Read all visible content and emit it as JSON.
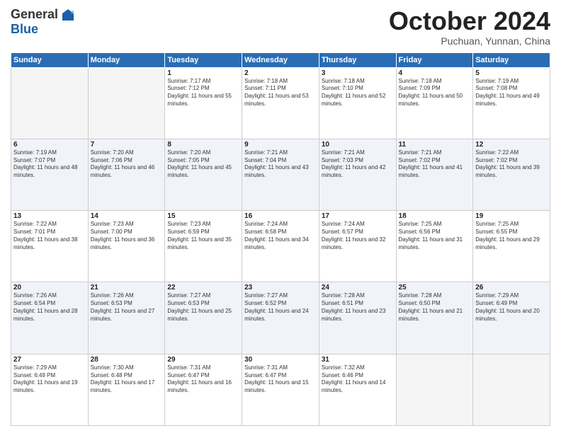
{
  "logo": {
    "general": "General",
    "blue": "Blue"
  },
  "title": "October 2024",
  "subtitle": "Puchuan, Yunnan, China",
  "weekdays": [
    "Sunday",
    "Monday",
    "Tuesday",
    "Wednesday",
    "Thursday",
    "Friday",
    "Saturday"
  ],
  "weeks": [
    [
      {
        "day": "",
        "empty": true
      },
      {
        "day": "",
        "empty": true
      },
      {
        "day": "1",
        "sunrise": "7:17 AM",
        "sunset": "7:12 PM",
        "daylight": "11 hours and 55 minutes."
      },
      {
        "day": "2",
        "sunrise": "7:18 AM",
        "sunset": "7:11 PM",
        "daylight": "11 hours and 53 minutes."
      },
      {
        "day": "3",
        "sunrise": "7:18 AM",
        "sunset": "7:10 PM",
        "daylight": "11 hours and 52 minutes."
      },
      {
        "day": "4",
        "sunrise": "7:18 AM",
        "sunset": "7:09 PM",
        "daylight": "11 hours and 50 minutes."
      },
      {
        "day": "5",
        "sunrise": "7:19 AM",
        "sunset": "7:08 PM",
        "daylight": "11 hours and 49 minutes."
      }
    ],
    [
      {
        "day": "6",
        "sunrise": "7:19 AM",
        "sunset": "7:07 PM",
        "daylight": "11 hours and 48 minutes."
      },
      {
        "day": "7",
        "sunrise": "7:20 AM",
        "sunset": "7:06 PM",
        "daylight": "11 hours and 46 minutes."
      },
      {
        "day": "8",
        "sunrise": "7:20 AM",
        "sunset": "7:05 PM",
        "daylight": "11 hours and 45 minutes."
      },
      {
        "day": "9",
        "sunrise": "7:21 AM",
        "sunset": "7:04 PM",
        "daylight": "11 hours and 43 minutes."
      },
      {
        "day": "10",
        "sunrise": "7:21 AM",
        "sunset": "7:03 PM",
        "daylight": "11 hours and 42 minutes."
      },
      {
        "day": "11",
        "sunrise": "7:21 AM",
        "sunset": "7:02 PM",
        "daylight": "11 hours and 41 minutes."
      },
      {
        "day": "12",
        "sunrise": "7:22 AM",
        "sunset": "7:02 PM",
        "daylight": "11 hours and 39 minutes."
      }
    ],
    [
      {
        "day": "13",
        "sunrise": "7:22 AM",
        "sunset": "7:01 PM",
        "daylight": "11 hours and 38 minutes."
      },
      {
        "day": "14",
        "sunrise": "7:23 AM",
        "sunset": "7:00 PM",
        "daylight": "11 hours and 36 minutes."
      },
      {
        "day": "15",
        "sunrise": "7:23 AM",
        "sunset": "6:59 PM",
        "daylight": "11 hours and 35 minutes."
      },
      {
        "day": "16",
        "sunrise": "7:24 AM",
        "sunset": "6:58 PM",
        "daylight": "11 hours and 34 minutes."
      },
      {
        "day": "17",
        "sunrise": "7:24 AM",
        "sunset": "6:57 PM",
        "daylight": "11 hours and 32 minutes."
      },
      {
        "day": "18",
        "sunrise": "7:25 AM",
        "sunset": "6:56 PM",
        "daylight": "11 hours and 31 minutes."
      },
      {
        "day": "19",
        "sunrise": "7:25 AM",
        "sunset": "6:55 PM",
        "daylight": "11 hours and 29 minutes."
      }
    ],
    [
      {
        "day": "20",
        "sunrise": "7:26 AM",
        "sunset": "6:54 PM",
        "daylight": "11 hours and 28 minutes."
      },
      {
        "day": "21",
        "sunrise": "7:26 AM",
        "sunset": "6:53 PM",
        "daylight": "11 hours and 27 minutes."
      },
      {
        "day": "22",
        "sunrise": "7:27 AM",
        "sunset": "6:53 PM",
        "daylight": "11 hours and 25 minutes."
      },
      {
        "day": "23",
        "sunrise": "7:27 AM",
        "sunset": "6:52 PM",
        "daylight": "11 hours and 24 minutes."
      },
      {
        "day": "24",
        "sunrise": "7:28 AM",
        "sunset": "6:51 PM",
        "daylight": "11 hours and 23 minutes."
      },
      {
        "day": "25",
        "sunrise": "7:28 AM",
        "sunset": "6:50 PM",
        "daylight": "11 hours and 21 minutes."
      },
      {
        "day": "26",
        "sunrise": "7:29 AM",
        "sunset": "6:49 PM",
        "daylight": "11 hours and 20 minutes."
      }
    ],
    [
      {
        "day": "27",
        "sunrise": "7:29 AM",
        "sunset": "6:49 PM",
        "daylight": "11 hours and 19 minutes."
      },
      {
        "day": "28",
        "sunrise": "7:30 AM",
        "sunset": "6:48 PM",
        "daylight": "11 hours and 17 minutes."
      },
      {
        "day": "29",
        "sunrise": "7:31 AM",
        "sunset": "6:47 PM",
        "daylight": "11 hours and 16 minutes."
      },
      {
        "day": "30",
        "sunrise": "7:31 AM",
        "sunset": "6:47 PM",
        "daylight": "11 hours and 15 minutes."
      },
      {
        "day": "31",
        "sunrise": "7:32 AM",
        "sunset": "6:46 PM",
        "daylight": "11 hours and 14 minutes."
      },
      {
        "day": "",
        "empty": true
      },
      {
        "day": "",
        "empty": true
      }
    ]
  ]
}
